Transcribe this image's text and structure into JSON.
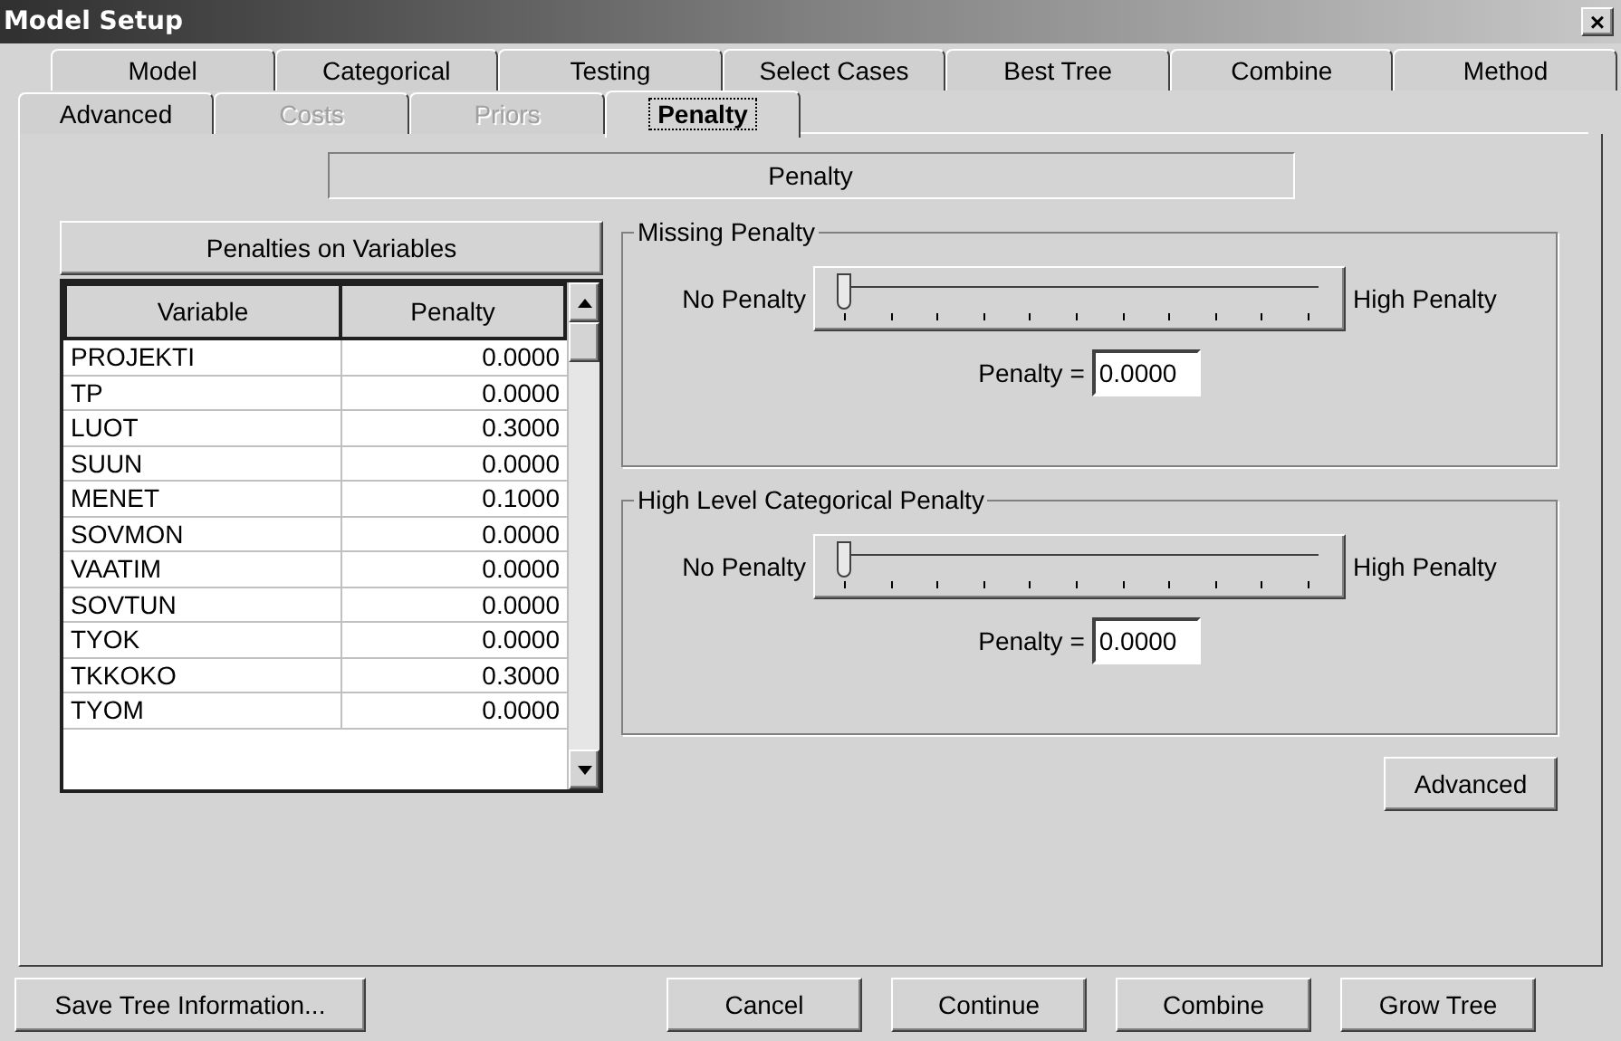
{
  "window": {
    "title": "Model Setup",
    "close": "×"
  },
  "tab_rows": [
    [
      {
        "label": "Model",
        "selected": false,
        "disabled": false
      },
      {
        "label": "Categorical",
        "selected": false,
        "disabled": false
      },
      {
        "label": "Testing",
        "selected": false,
        "disabled": false
      },
      {
        "label": "Select Cases",
        "selected": false,
        "disabled": false
      },
      {
        "label": "Best Tree",
        "selected": false,
        "disabled": false
      },
      {
        "label": "Combine",
        "selected": false,
        "disabled": false
      },
      {
        "label": "Method",
        "selected": false,
        "disabled": false
      }
    ],
    [
      {
        "label": "Advanced",
        "selected": false,
        "disabled": false
      },
      {
        "label": "Costs",
        "selected": false,
        "disabled": true
      },
      {
        "label": "Priors",
        "selected": false,
        "disabled": true
      },
      {
        "label": "Penalty",
        "selected": true,
        "disabled": false
      }
    ]
  ],
  "panel_title": "Penalty",
  "variables_table": {
    "title": "Penalties on Variables",
    "columns": [
      "Variable",
      "Penalty"
    ],
    "rows": [
      [
        "PROJEKTI",
        "0.0000"
      ],
      [
        "TP",
        "0.0000"
      ],
      [
        "LUOT",
        "0.3000"
      ],
      [
        "SUUN",
        "0.0000"
      ],
      [
        "MENET",
        "0.1000"
      ],
      [
        "SOVMON",
        "0.0000"
      ],
      [
        "VAATIM",
        "0.0000"
      ],
      [
        "SOVTUN",
        "0.0000"
      ],
      [
        "TYOK",
        "0.0000"
      ],
      [
        "TKKOKO",
        "0.3000"
      ],
      [
        "TYOM",
        "0.0000"
      ]
    ]
  },
  "groups": [
    {
      "title": "Missing Penalty",
      "low_label": "No Penalty",
      "high_label": "High Penalty",
      "level": 0,
      "value_label": "Penalty =",
      "value": "0.0000"
    },
    {
      "title": "High Level Categorical Penalty",
      "low_label": "No Penalty",
      "high_label": "High Penalty",
      "level": 0,
      "value_label": "Penalty =",
      "value": "0.0000"
    }
  ],
  "advanced_button": "Advanced",
  "footer_buttons": [
    "Save Tree Information...",
    "Cancel",
    "Continue",
    "Combine",
    "Grow Tree"
  ]
}
